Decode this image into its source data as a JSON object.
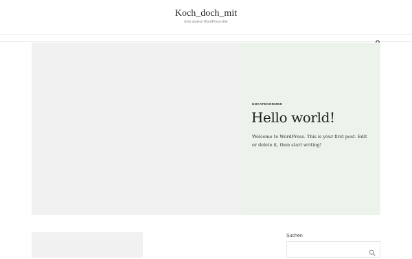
{
  "site": {
    "title": "Koch_doch_mit",
    "tagline": "Eine andere WordPress-Site"
  },
  "nav": {
    "search_icon": "search-icon"
  },
  "hero_post": {
    "category": "UNCATEGORIZED",
    "title": "Hello world!",
    "excerpt": "Welcome to WordPress. This is your first post. Edit or delete it, then start writing!",
    "panel_color": "#ebf3eb",
    "image_color": "#f1f1f1"
  },
  "sidebar": {
    "search_label": "Suchen",
    "search_placeholder": "",
    "search_button_icon": "search-icon"
  }
}
